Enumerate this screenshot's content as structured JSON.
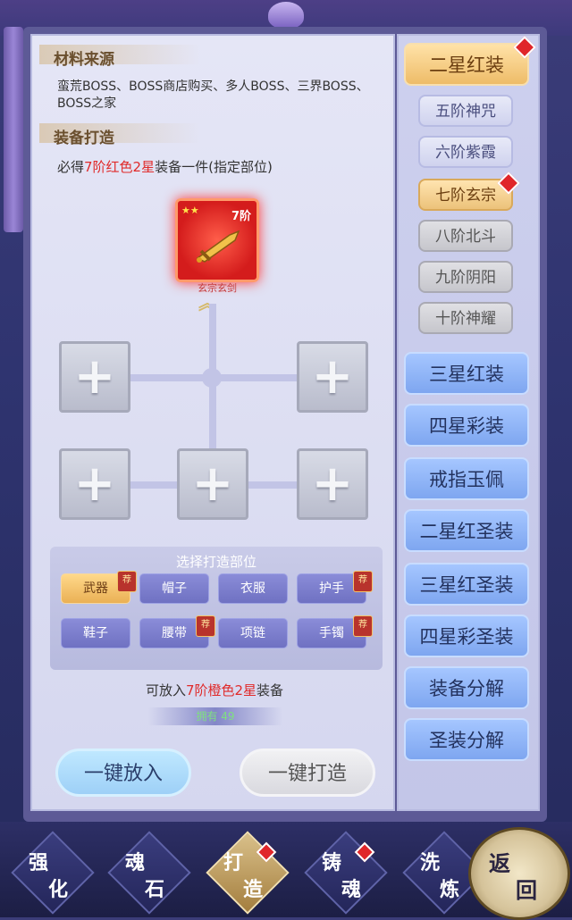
{
  "materials": {
    "title": "材料来源",
    "desc": "蛮荒BOSS、BOSS商店购买、多人BOSS、三界BOSS、BOSS之家"
  },
  "forge": {
    "title": "装备打造",
    "guarantee_prefix": "必得",
    "guarantee_highlight": "7阶红色2星",
    "guarantee_suffix": "装备一件(指定部位)",
    "result_item": {
      "level": "7阶",
      "stars": "★★",
      "name": "玄宗玄剑"
    },
    "hint_prefix": "可放入",
    "hint_highlight": "7阶橙色2星",
    "hint_suffix": "装备",
    "count": "拥有 49"
  },
  "part_select": {
    "title": "选择打造部位",
    "rec_label": "荐",
    "parts": [
      {
        "label": "武器",
        "active": true,
        "recommended": true
      },
      {
        "label": "帽子",
        "active": false,
        "recommended": false
      },
      {
        "label": "衣服",
        "active": false,
        "recommended": false
      },
      {
        "label": "护手",
        "active": false,
        "recommended": true
      },
      {
        "label": "鞋子",
        "active": false,
        "recommended": false
      },
      {
        "label": "腰带",
        "active": false,
        "recommended": true
      },
      {
        "label": "项链",
        "active": false,
        "recommended": false
      },
      {
        "label": "手镯",
        "active": false,
        "recommended": true
      }
    ]
  },
  "buttons": {
    "put_all": "一键放入",
    "forge_all": "一键打造"
  },
  "right_tabs": [
    {
      "label": "二星红装",
      "type": "main",
      "selected": true,
      "dot": true
    },
    {
      "label": "五阶神咒",
      "type": "sub",
      "state": "normal",
      "dot": false
    },
    {
      "label": "六阶紫霞",
      "type": "sub",
      "state": "normal",
      "dot": false
    },
    {
      "label": "七阶玄宗",
      "type": "sub",
      "state": "selected",
      "dot": true
    },
    {
      "label": "八阶北斗",
      "type": "sub",
      "state": "gray",
      "dot": false
    },
    {
      "label": "九阶阴阳",
      "type": "sub",
      "state": "gray",
      "dot": false
    },
    {
      "label": "十阶神耀",
      "type": "sub",
      "state": "gray",
      "dot": false
    },
    {
      "label": "三星红装",
      "type": "main",
      "selected": false,
      "dot": false
    },
    {
      "label": "四星彩装",
      "type": "main",
      "selected": false,
      "dot": false
    },
    {
      "label": "戒指玉佩",
      "type": "main",
      "selected": false,
      "dot": false
    },
    {
      "label": "二星红圣装",
      "type": "main",
      "selected": false,
      "dot": false
    },
    {
      "label": "三星红圣装",
      "type": "main",
      "selected": false,
      "dot": false
    },
    {
      "label": "四星彩圣装",
      "type": "main",
      "selected": false,
      "dot": false
    },
    {
      "label": "装备分解",
      "type": "main",
      "selected": false,
      "dot": false
    },
    {
      "label": "圣装分解",
      "type": "main",
      "selected": false,
      "dot": false
    }
  ],
  "bottom_tabs": [
    {
      "c1": "强",
      "c2": "化",
      "selected": false,
      "dot": false
    },
    {
      "c1": "魂",
      "c2": "石",
      "selected": false,
      "dot": false
    },
    {
      "c1": "打",
      "c2": "造",
      "selected": true,
      "dot": true
    },
    {
      "c1": "铸",
      "c2": "魂",
      "selected": false,
      "dot": true
    },
    {
      "c1": "洗",
      "c2": "炼",
      "selected": false,
      "dot": false
    }
  ],
  "back": {
    "c1": "返",
    "c2": "回"
  }
}
